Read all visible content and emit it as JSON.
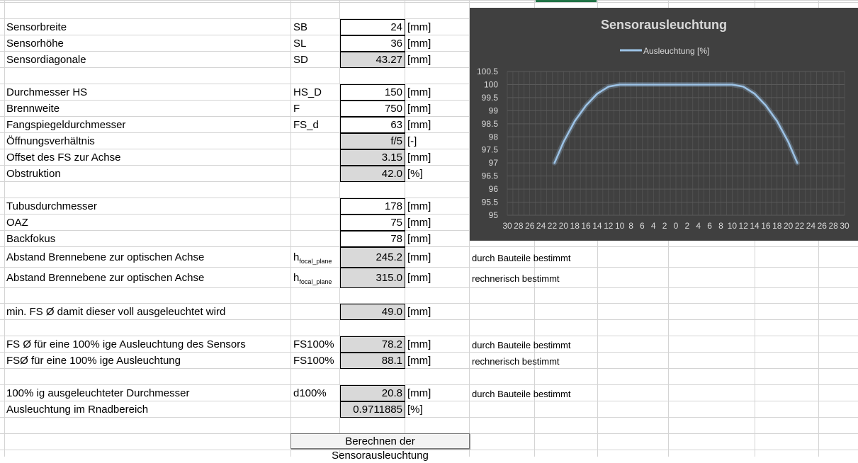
{
  "rows": [
    {
      "label": "Sensorbreite",
      "abbr": "SB",
      "value": "24",
      "unit": "[mm]",
      "kind": "in"
    },
    {
      "label": "Sensorhöhe",
      "abbr": "SL",
      "value": "36",
      "unit": "[mm]",
      "kind": "in"
    },
    {
      "label": "Sensordiagonale",
      "abbr": "SD",
      "value": "43.27",
      "unit": "[mm]",
      "kind": "out"
    },
    {
      "label": "Durchmesser HS",
      "abbr": "HS_D",
      "value": "150",
      "unit": "[mm]",
      "kind": "in"
    },
    {
      "label": "Brennweite",
      "abbr": "F",
      "value": "750",
      "unit": "[mm]",
      "kind": "in"
    },
    {
      "label": "Fangspiegeldurchmesser",
      "abbr": "FS_d",
      "value": "63",
      "unit": "[mm]",
      "kind": "in"
    },
    {
      "label": "Öffnungsverhältnis",
      "abbr": "",
      "value": "f/5",
      "unit": "[-]",
      "kind": "out"
    },
    {
      "label": "Offset des FS zur Achse",
      "abbr": "",
      "value": "3.15",
      "unit": "[mm]",
      "kind": "out"
    },
    {
      "label": "Obstruktion",
      "abbr": "",
      "value": "42.0",
      "unit": "[%]",
      "kind": "out"
    },
    {
      "label": "Tubusdurchmesser",
      "abbr": "",
      "value": "178",
      "unit": "[mm]",
      "kind": "in"
    },
    {
      "label": "OAZ",
      "abbr": "",
      "value": "75",
      "unit": "[mm]",
      "kind": "in"
    },
    {
      "label": "Backfokus",
      "abbr": "",
      "value": "78",
      "unit": "[mm]",
      "kind": "in"
    },
    {
      "label": "Abstand Brennebene zur optischen Achse",
      "abbr": "h",
      "abbr_sub": "focal_plane",
      "value": "245.2",
      "unit": "[mm]",
      "kind": "out",
      "note": "durch Bauteile bestimmt"
    },
    {
      "label": "Abstand Brennebene zur optischen Achse",
      "abbr": "h",
      "abbr_sub": "focal_plane",
      "value": "315.0",
      "unit": "[mm]",
      "kind": "out",
      "note": "rechnerisch bestimmt"
    },
    {
      "label": "min. FS Ø damit dieser voll ausgeleuchtet wird",
      "abbr": "",
      "value": "49.0",
      "unit": "[mm]",
      "kind": "out"
    },
    {
      "label": "FS Ø für eine 100% ige Ausleuchtung des Sensors",
      "abbr": "FS100%",
      "value": "78.2",
      "unit": "[mm]",
      "kind": "out",
      "note": "durch Bauteile bestimmt"
    },
    {
      "label": "FSØ für eine 100% ige Ausleuchtung",
      "abbr": "FS100%",
      "value": "88.1",
      "unit": "[mm]",
      "kind": "out",
      "note": "rechnerisch bestimmt"
    },
    {
      "label": "100% ig ausgeleuchteter Durchmesser",
      "abbr": "d100%",
      "value": "20.8",
      "unit": "[mm]",
      "kind": "out",
      "note": "durch Bauteile bestimmt"
    },
    {
      "label": "Ausleuchtung im Rnadbereich",
      "abbr": "",
      "value": "0.9711885",
      "unit": "[%]",
      "kind": "out"
    }
  ],
  "button": {
    "label": "Berechnen der Sensorausleuchtung"
  },
  "chart_data": {
    "type": "line",
    "title": "Sensorausleuchtung",
    "legend_position": "top",
    "grid": true,
    "colors": {
      "background": "#404040",
      "line": "#9dc3e6",
      "text": "#d9d9d9",
      "grid": "#5a5a5a"
    },
    "series": [
      {
        "name": "Ausleuchtung [%]",
        "x": [
          -21.6,
          -20,
          -18,
          -16,
          -14,
          -12,
          -10,
          -8,
          -6,
          -4,
          -2,
          0,
          2,
          4,
          6,
          8,
          10,
          12,
          14,
          16,
          18,
          20,
          21.6
        ],
        "y": [
          97.0,
          97.8,
          98.6,
          99.2,
          99.65,
          99.92,
          100,
          100,
          100,
          100,
          100,
          100,
          100,
          100,
          100,
          100,
          100,
          99.92,
          99.65,
          99.2,
          98.6,
          97.8,
          97.0
        ]
      }
    ],
    "ylim": [
      95,
      100.5
    ],
    "yticks": [
      "95",
      "95.5",
      "96",
      "96.5",
      "97",
      "97.5",
      "98",
      "98.5",
      "99",
      "99.5",
      "100",
      "100.5"
    ],
    "xtick_labels": [
      "30",
      "28",
      "26",
      "24",
      "22",
      "20",
      "18",
      "16",
      "14",
      "12",
      "10",
      "8",
      "6",
      "4",
      "2",
      "0",
      "2",
      "4",
      "6",
      "8",
      "10",
      "12",
      "14",
      "16",
      "18",
      "20",
      "22",
      "24",
      "26",
      "28",
      "30"
    ],
    "xlim": [
      -30,
      30
    ]
  }
}
